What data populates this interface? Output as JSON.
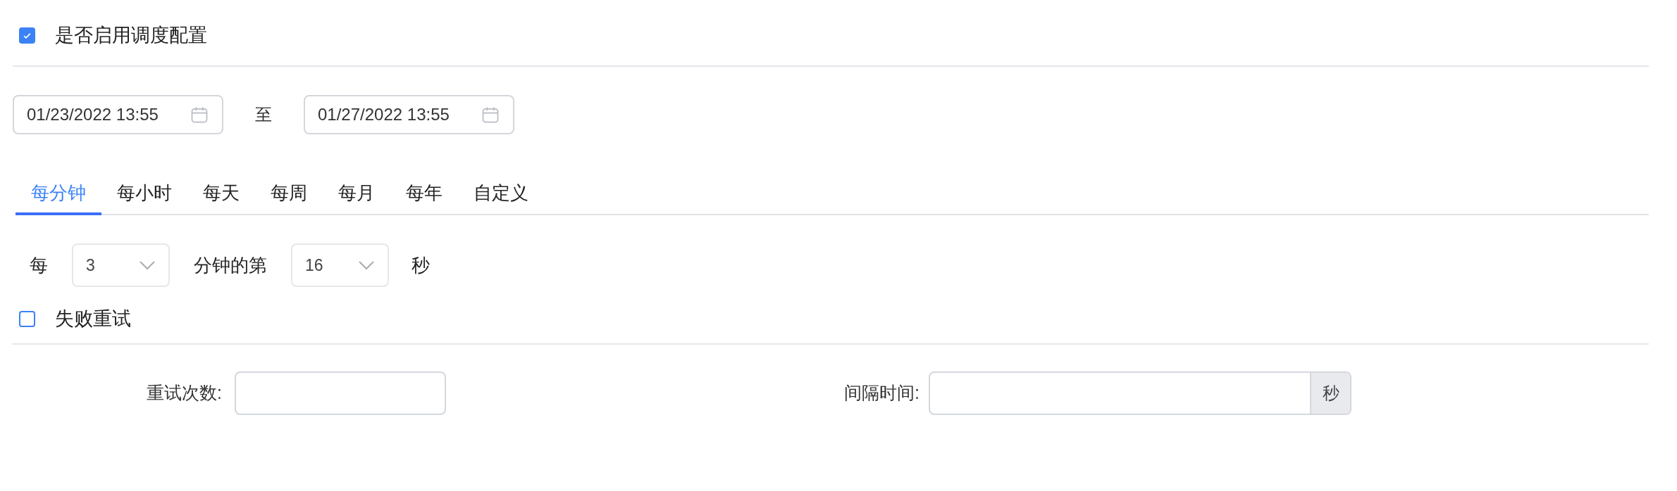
{
  "schedule_toggle": {
    "label": "是否启用调度配置",
    "checked": true
  },
  "date_range": {
    "start": "01/23/2022 13:55",
    "separator": "至",
    "end": "01/27/2022 13:55"
  },
  "tabs": [
    {
      "label": "每分钟",
      "selected": true
    },
    {
      "label": "每小时",
      "selected": false
    },
    {
      "label": "每天",
      "selected": false
    },
    {
      "label": "每周",
      "selected": false
    },
    {
      "label": "每月",
      "selected": false
    },
    {
      "label": "每年",
      "selected": false
    },
    {
      "label": "自定义",
      "selected": false
    }
  ],
  "interval_row": {
    "prefix": "每",
    "interval": "3",
    "middle": "分钟的第",
    "second": "16",
    "suffix": "秒"
  },
  "retry_toggle": {
    "label": "失败重试",
    "checked": false
  },
  "retry_fields": {
    "count_label": "重试次数:",
    "delay_label": "间隔时间:",
    "delay_unit": "秒"
  }
}
